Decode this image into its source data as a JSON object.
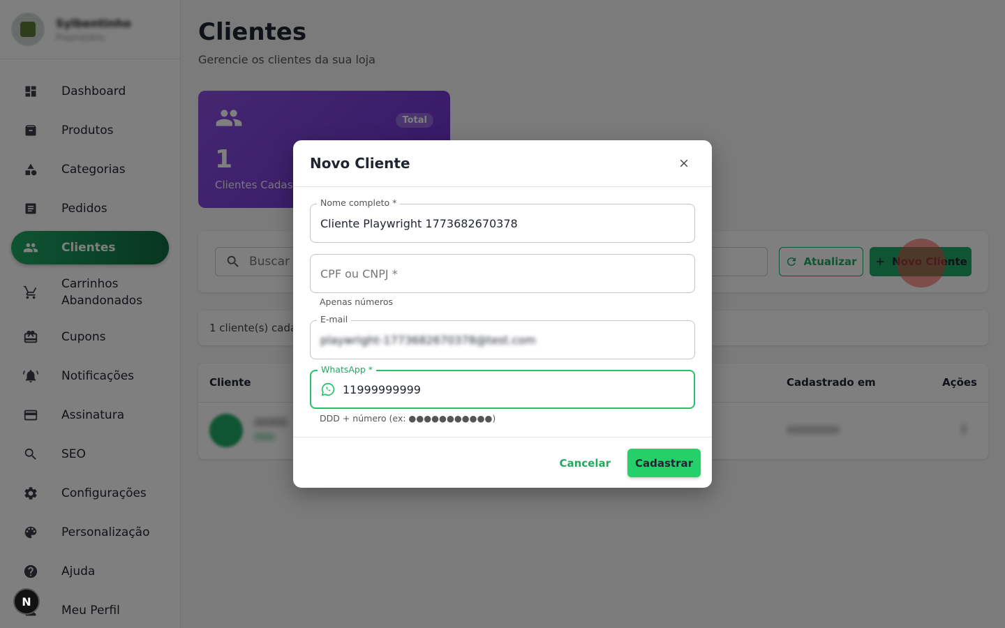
{
  "sidebar": {
    "profile": {
      "name": "Sylbentinho",
      "subtitle": "Proprietário"
    },
    "items": [
      {
        "label": "Dashboard",
        "icon": "dashboard-icon",
        "active": false
      },
      {
        "label": "Produtos",
        "icon": "archive-icon",
        "active": false
      },
      {
        "label": "Categorias",
        "icon": "category-icon",
        "active": false
      },
      {
        "label": "Pedidos",
        "icon": "list-icon",
        "active": false
      },
      {
        "label": "Clientes",
        "icon": "people-icon",
        "active": true
      },
      {
        "label": "Carrinhos Abandonados",
        "icon": "cart-icon",
        "active": false
      },
      {
        "label": "Cupons",
        "icon": "coupon-icon",
        "active": false
      },
      {
        "label": "Notificações",
        "icon": "bell-icon",
        "active": false
      },
      {
        "label": "Assinatura",
        "icon": "credit-card-icon",
        "active": false
      },
      {
        "label": "SEO",
        "icon": "search-icon",
        "active": false
      },
      {
        "label": "Configurações",
        "icon": "gear-icon",
        "active": false
      },
      {
        "label": "Personalização",
        "icon": "palette-icon",
        "active": false
      },
      {
        "label": "Ajuda",
        "icon": "help-icon",
        "active": false
      },
      {
        "label": "Meu Perfil",
        "icon": "user-icon",
        "active": false
      }
    ],
    "dev_badge": "N"
  },
  "page": {
    "title": "Clientes",
    "subtitle": "Gerencie os clientes da sua loja"
  },
  "stat_card": {
    "badge": "Total",
    "value": "1",
    "label": "Clientes Cadastrados"
  },
  "toolbar": {
    "search_placeholder": "Buscar por nome, CPF, e-mail ou WhatsApp",
    "refresh_label": "Atualizar",
    "new_label": "Novo Cliente"
  },
  "count_text": "1 cliente(s) cadastrado(s)",
  "table": {
    "columns": [
      "Cliente",
      "Cadastrado em",
      "Ações"
    ]
  },
  "modal": {
    "title": "Novo Cliente",
    "fields": {
      "name": {
        "label": "Nome completo *",
        "value": "Cliente Playwright 1773682670378"
      },
      "cpf": {
        "placeholder": "CPF ou CNPJ *",
        "helper": "Apenas números"
      },
      "email": {
        "label": "E-mail",
        "value": "playwright-1773682670378@test.com"
      },
      "whatsapp": {
        "label": "WhatsApp *",
        "value": "11999999999",
        "helper": "DDD + número (ex: ●●●●●●●●●●●)"
      }
    },
    "cancel_label": "Cancelar",
    "submit_label": "Cadastrar"
  },
  "colors": {
    "accent": "#1fa866",
    "accent_bright": "#25d06b",
    "stat_card": "#7a3fd8"
  }
}
